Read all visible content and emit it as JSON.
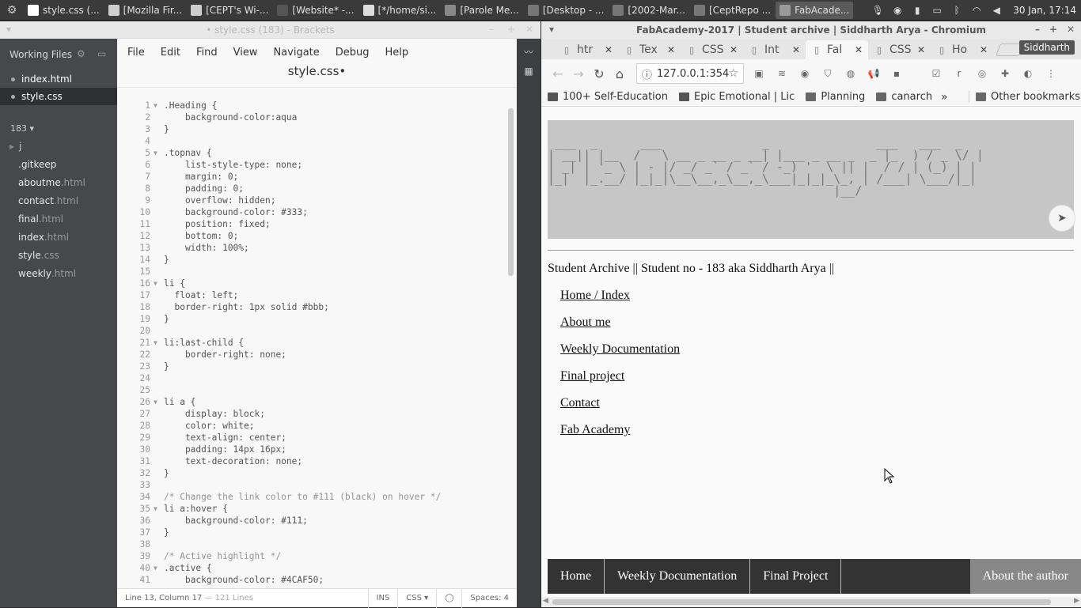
{
  "taskbar": {
    "tasks": [
      {
        "label": "style.css (...",
        "color": "#ffffff"
      },
      {
        "label": "[Mozilla Fir...",
        "color": "#cfcfcf"
      },
      {
        "label": "[CEPT's Wi-...",
        "color": "#cfcfcf"
      },
      {
        "label": "[Website* -...",
        "color": "#555555"
      },
      {
        "label": "[*/home/si...",
        "color": "#dddddd"
      },
      {
        "label": "[Parole Me...",
        "color": "#888888"
      },
      {
        "label": "[Desktop - ...",
        "color": "#777777"
      },
      {
        "label": "[2002-Mar...",
        "color": "#777777"
      },
      {
        "label": "[CeptRepo ...",
        "color": "#777777"
      },
      {
        "label": "FabAcade...",
        "color": "#9a9a9a"
      }
    ],
    "clock": "30 Jan, 17:14"
  },
  "brackets": {
    "title": "• style.css (183) - Brackets",
    "working_files_label": "Working Files",
    "working_files": [
      {
        "name": "index",
        "ext": ".html"
      },
      {
        "name": "style",
        "ext": ".css"
      }
    ],
    "project_label": "183 ▾",
    "tree": [
      {
        "name": "j",
        "ext": ""
      },
      {
        "name": ".gitkeep",
        "ext": ""
      },
      {
        "name": "aboutme",
        "ext": ".html"
      },
      {
        "name": "contact",
        "ext": ".html"
      },
      {
        "name": "final",
        "ext": ".html"
      },
      {
        "name": "index",
        "ext": ".html"
      },
      {
        "name": "style",
        "ext": ".css"
      },
      {
        "name": "weekly",
        "ext": ".html"
      }
    ],
    "menus": [
      "File",
      "Edit",
      "Find",
      "View",
      "Navigate",
      "Debug",
      "Help"
    ],
    "filename": "style.css•",
    "code_lines": [
      {
        "n": "1",
        "fold": true,
        "text": ".Heading {"
      },
      {
        "n": "2",
        "fold": false,
        "text": "    background-color:aqua"
      },
      {
        "n": "3",
        "fold": false,
        "text": "}"
      },
      {
        "n": "4",
        "fold": false,
        "text": ""
      },
      {
        "n": "5",
        "fold": true,
        "text": ".topnav {"
      },
      {
        "n": "6",
        "fold": false,
        "text": "    list-style-type: none;"
      },
      {
        "n": "7",
        "fold": false,
        "text": "    margin: 0;"
      },
      {
        "n": "8",
        "fold": false,
        "text": "    padding: 0;"
      },
      {
        "n": "9",
        "fold": false,
        "text": "    overflow: hidden;"
      },
      {
        "n": "10",
        "fold": false,
        "text": "    background-color: #333;"
      },
      {
        "n": "11",
        "fold": false,
        "text": "    position: fixed;"
      },
      {
        "n": "12",
        "fold": false,
        "text": "    bottom: 0;"
      },
      {
        "n": "13",
        "fold": false,
        "text": "    width: 100%;"
      },
      {
        "n": "14",
        "fold": false,
        "text": "}"
      },
      {
        "n": "15",
        "fold": false,
        "text": ""
      },
      {
        "n": "16",
        "fold": true,
        "text": "li {"
      },
      {
        "n": "17",
        "fold": false,
        "text": "  float: left;"
      },
      {
        "n": "18",
        "fold": false,
        "text": "  border-right: 1px solid #bbb;"
      },
      {
        "n": "19",
        "fold": false,
        "text": "}"
      },
      {
        "n": "20",
        "fold": false,
        "text": ""
      },
      {
        "n": "21",
        "fold": true,
        "text": "li:last-child {"
      },
      {
        "n": "22",
        "fold": false,
        "text": "    border-right: none;"
      },
      {
        "n": "23",
        "fold": false,
        "text": "}"
      },
      {
        "n": "24",
        "fold": false,
        "text": ""
      },
      {
        "n": "25",
        "fold": false,
        "text": ""
      },
      {
        "n": "26",
        "fold": true,
        "text": "li a {"
      },
      {
        "n": "27",
        "fold": false,
        "text": "    display: block;"
      },
      {
        "n": "28",
        "fold": false,
        "text": "    color: white;"
      },
      {
        "n": "29",
        "fold": false,
        "text": "    text-align: center;"
      },
      {
        "n": "30",
        "fold": false,
        "text": "    padding: 14px 16px;"
      },
      {
        "n": "31",
        "fold": false,
        "text": "    text-decoration: none;"
      },
      {
        "n": "32",
        "fold": false,
        "text": "}"
      },
      {
        "n": "33",
        "fold": false,
        "text": ""
      },
      {
        "n": "34",
        "fold": false,
        "text": "/* Change the link color to #111 (black) on hover */"
      },
      {
        "n": "35",
        "fold": true,
        "text": "li a:hover {"
      },
      {
        "n": "36",
        "fold": false,
        "text": "    background-color: #111;"
      },
      {
        "n": "37",
        "fold": false,
        "text": "}"
      },
      {
        "n": "38",
        "fold": false,
        "text": ""
      },
      {
        "n": "39",
        "fold": false,
        "text": "/* Active highlight */"
      },
      {
        "n": "40",
        "fold": true,
        "text": ".active {"
      },
      {
        "n": "41",
        "fold": false,
        "text": "    background-color: #4CAF50;"
      }
    ],
    "status": {
      "position": "Line 13, Column 17",
      "lines": " — 121 Lines",
      "mode": "INS",
      "language": "CSS",
      "spaces": "Spaces: 4"
    }
  },
  "chromium": {
    "title": "FabAcademy-2017 | Student archive | Siddharth Arya - Chromium",
    "tabs": [
      "htr",
      "Tex",
      "CSS",
      "Int",
      "Fal",
      "CSS",
      "Ho"
    ],
    "active_tab_index": 4,
    "profile": "Siddharth",
    "url": "127.0.0.1:354",
    "bookmarks": [
      "100+ Self-Education",
      "Epic Emotional | Lic",
      "Planning",
      "canarch"
    ],
    "other_bookmarks": "Other bookmarks",
    "page": {
      "banner_ascii": " ___  _      ___              _               ___   ___  _ \n| __|| |__  /   \\ __ _ __ _ __| |___ _ __ _  _ |_  ) / _ \\/ |\n| _| | '_ \\ | - |/ _/ _` / _` / -_) '  \\ || |  / / | (_) | |\n|_|  |_.__/ |_|_|\\__\\__,_\\__,_\\___|_|_|_\\_, | /___| \\___/|_|\n                                        |__/               ",
      "archive_text": "Student Archive || Student no - 183 aka Siddharth Arya ||",
      "links": [
        "Home / Index",
        "About me",
        "Weekly Documentation",
        "Final project",
        "Contact",
        "Fab Academy"
      ],
      "topnav": [
        "Home",
        "Weekly Documentation",
        "Final Project"
      ],
      "topnav_author": "About the author"
    }
  }
}
